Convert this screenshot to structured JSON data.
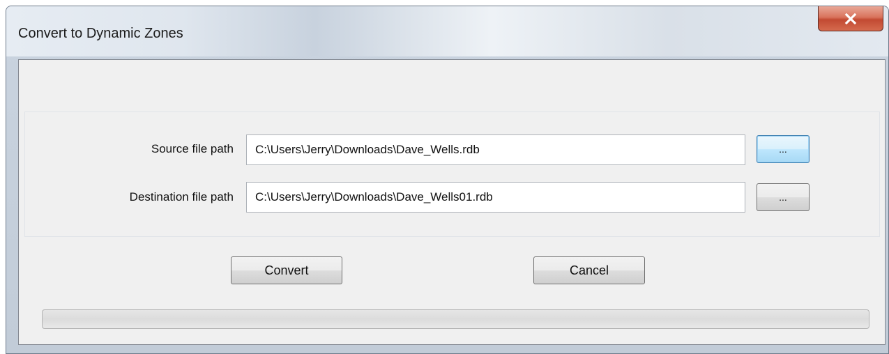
{
  "window": {
    "title": "Convert to Dynamic Zones"
  },
  "form": {
    "source_label": "Source file path",
    "source_value": "C:\\Users\\Jerry\\Downloads\\Dave_Wells.rdb",
    "source_browse_label": "...",
    "destination_label": "Destination file path",
    "destination_value": "C:\\Users\\Jerry\\Downloads\\Dave_Wells01.rdb",
    "destination_browse_label": "..."
  },
  "actions": {
    "convert_label": "Convert",
    "cancel_label": "Cancel"
  },
  "progress": {
    "value": 0
  },
  "icons": {
    "close": "close-icon"
  }
}
